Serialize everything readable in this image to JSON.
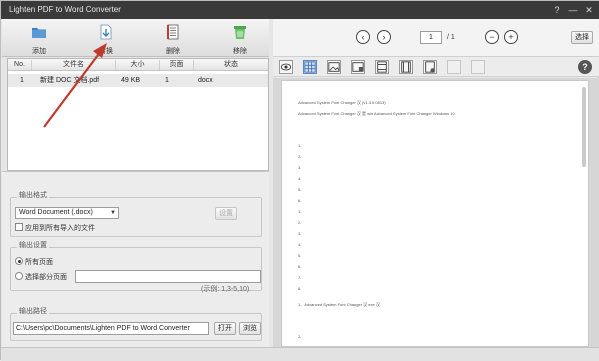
{
  "window": {
    "title": "Lighten PDF to Word Converter",
    "help": "?",
    "minimize": "—",
    "close": "✕"
  },
  "toolbar": {
    "add": "添加",
    "convert": "转换",
    "delete": "删除",
    "remove": "移除"
  },
  "table": {
    "headers": [
      "No.",
      "文件名",
      "大小",
      "页面",
      "状态"
    ],
    "rows": [
      {
        "no": "1",
        "name": "新建 DOC 文档.pdf",
        "size": "49 KB",
        "pages": "1",
        "status": "docx"
      }
    ]
  },
  "output_format": {
    "legend": "输出格式",
    "format": "Word Document (.docx)",
    "setting_button": "设置",
    "apply_all": "应用到所有导入的文件"
  },
  "output_settings": {
    "legend": "输出设置",
    "all_pages": "所有页面",
    "select_pages": "选择部分页面",
    "example": "(示例: 1,3-5,10)"
  },
  "output_path": {
    "legend": "输出路径",
    "path": "C:\\Users\\pc\\Documents\\Lighten PDF to Word Converter",
    "open_button": "打开",
    "browse_button": "浏览"
  },
  "viewer": {
    "page_current": "1",
    "page_total": "/ 1",
    "select_button": "选择"
  },
  "document": {
    "lines": [
      "Advanced System Font Changer 汉 (v1.3.0.0813)",
      "Advanced System Font Changer 汉 是 win Advanced System Font Changer Windows 10",
      "1.",
      "2.",
      "3.",
      "4.",
      "5.",
      "6.",
      "1.",
      "2.",
      "3.",
      "4.",
      "5.",
      "6.",
      "7.",
      "8.",
      "1、Advanced System Font Changer 汉 exe 汉",
      "2."
    ]
  },
  "colors": {
    "titlebar": "#3a3a3a",
    "arrow": "#c0392b",
    "add_icon": "#3a7fc4",
    "remove_icon": "#4aa84a"
  }
}
